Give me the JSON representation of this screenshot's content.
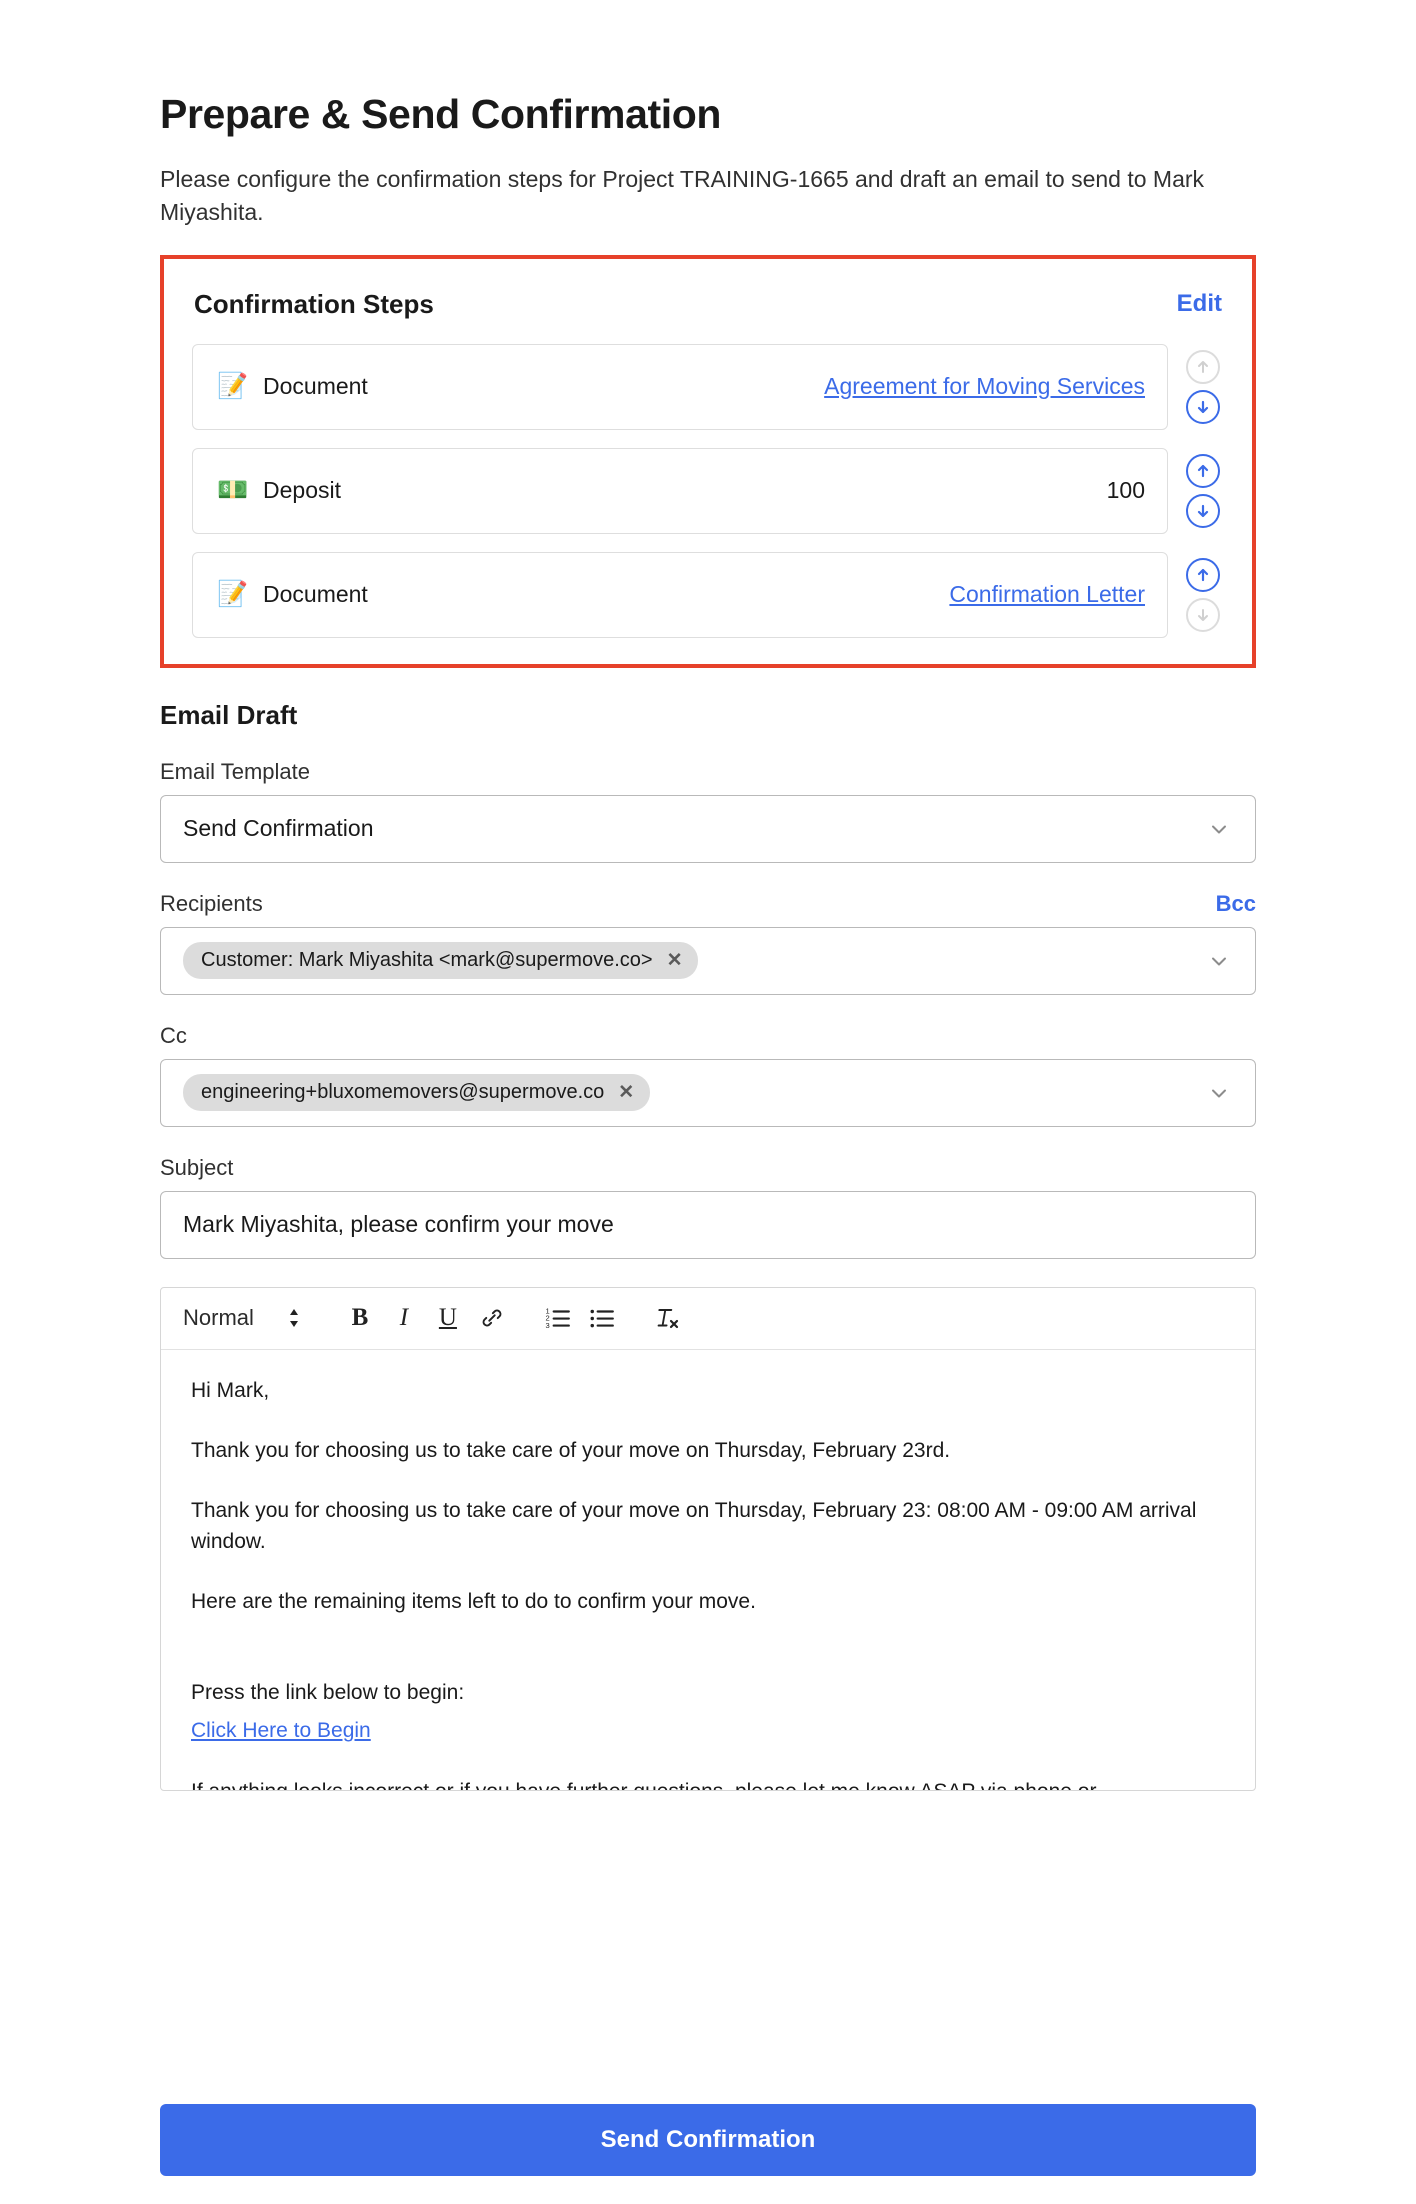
{
  "header": {
    "title": "Prepare & Send Confirmation",
    "description": "Please configure the confirmation steps for Project TRAINING-1665 and draft an email to send to Mark Miyashita."
  },
  "colors": {
    "accent_blue": "#3B6BE8",
    "highlight_red": "#E6412A",
    "chip_gray": "#DCDCDC"
  },
  "confirmation_steps": {
    "title": "Confirmation Steps",
    "edit_label": "Edit",
    "rows": [
      {
        "icon": "memo-icon",
        "emoji": "📝",
        "label": "Document",
        "value": "Agreement for Moving Services",
        "value_is_link": true,
        "up_enabled": false,
        "down_enabled": true
      },
      {
        "icon": "money-icon",
        "emoji": "💵",
        "label": "Deposit",
        "value": "100",
        "value_is_link": false,
        "up_enabled": true,
        "down_enabled": true
      },
      {
        "icon": "memo-icon",
        "emoji": "📝",
        "label": "Document",
        "value": "Confirmation Letter",
        "value_is_link": true,
        "up_enabled": true,
        "down_enabled": false
      }
    ]
  },
  "email_draft": {
    "section_title": "Email Draft",
    "template": {
      "label": "Email Template",
      "value": "Send Confirmation"
    },
    "recipients": {
      "label": "Recipients",
      "bcc_label": "Bcc",
      "chips": [
        "Customer: Mark Miyashita <mark@supermove.co>"
      ],
      "chip_remove_label": "✕"
    },
    "cc": {
      "label": "Cc",
      "chips": [
        "engineering+bluxomemovers@supermove.co"
      ],
      "chip_remove_label": "✕"
    },
    "subject": {
      "label": "Subject",
      "value": "Mark Miyashita, please confirm your move"
    },
    "toolbar": {
      "format_label": "Normal",
      "bold_label": "B",
      "italic_label": "I",
      "underline_label": "U"
    },
    "body": {
      "greeting": "Hi Mark,",
      "paragraph_1": "Thank you for choosing us to take care of your move on Thursday, February 23rd.",
      "paragraph_2": "Thank you for choosing us to take care of your move on Thursday, February 23: 08:00 AM - 09:00 AM arrival window.",
      "paragraph_3": "Here are the remaining items left to do to confirm your move.",
      "paragraph_4": "Press the link below to begin:",
      "link_text": "Click Here to Begin",
      "paragraph_5": "If anything looks incorrect or if you have further questions, please let me know ASAP via phone or"
    }
  },
  "footer": {
    "send_label": "Send Confirmation"
  }
}
